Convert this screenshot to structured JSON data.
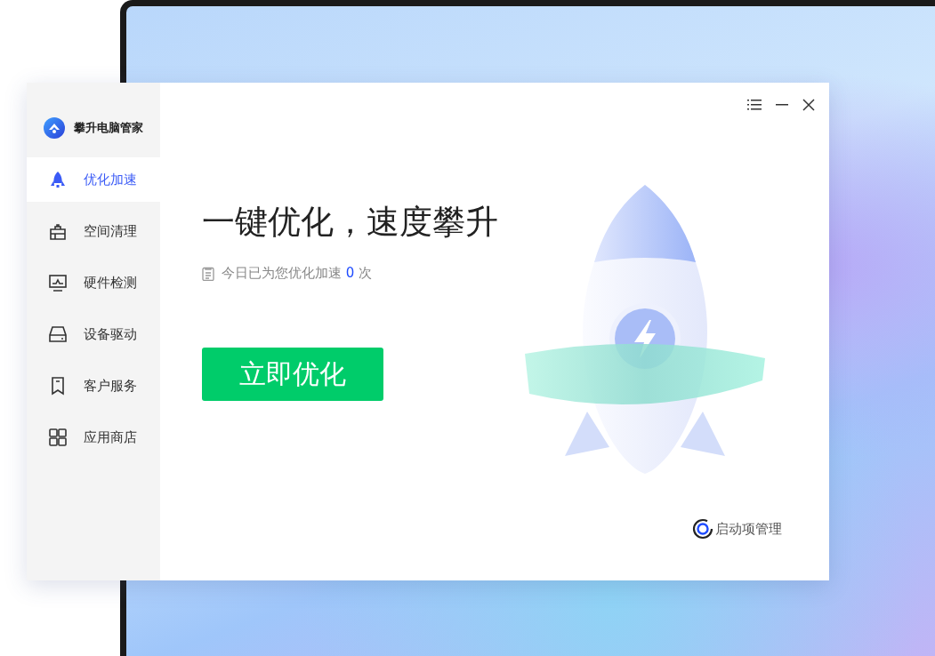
{
  "app": {
    "title": "攀升电脑管家"
  },
  "sidebar": {
    "items": [
      {
        "label": "优化加速",
        "selected": true
      },
      {
        "label": "空间清理",
        "selected": false
      },
      {
        "label": "硬件检测",
        "selected": false
      },
      {
        "label": "设备驱动",
        "selected": false
      },
      {
        "label": "客户服务",
        "selected": false
      },
      {
        "label": "应用商店",
        "selected": false
      }
    ]
  },
  "main": {
    "headline": "一键优化，速度攀升",
    "stat_prefix": "今日已为您优化加速",
    "stat_count": "0",
    "stat_suffix": "次",
    "primary_button": "立即优化",
    "footer_link": "启动项管理"
  }
}
